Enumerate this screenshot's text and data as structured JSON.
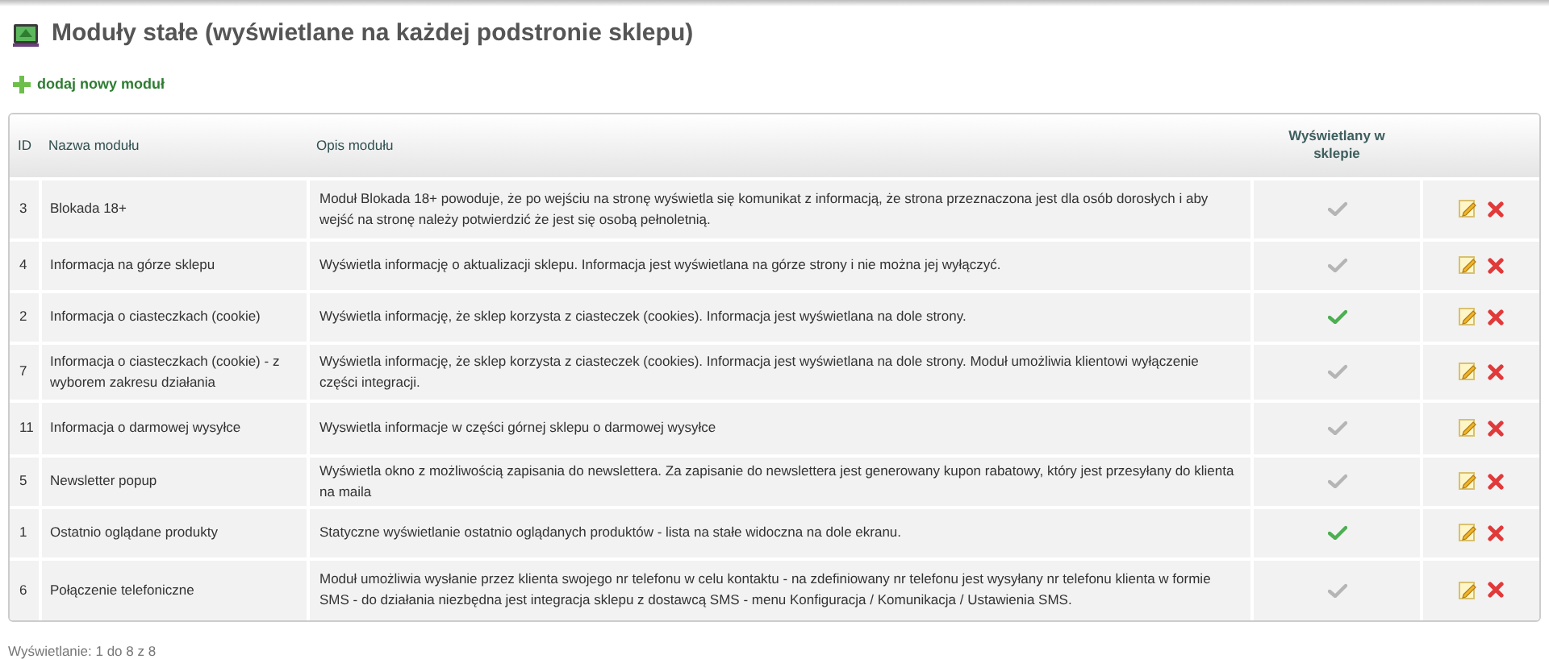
{
  "page_title": "Moduły stałe (wyświetlane na każdej podstronie sklepu)",
  "add_link": "dodaj nowy moduł",
  "table": {
    "columns": [
      "ID",
      "Nazwa modułu",
      "Opis modułu",
      "Wyświetlany w sklepie"
    ],
    "rows": [
      {
        "id": "3",
        "name": "Blokada 18+",
        "description": "Moduł Blokada 18+ powoduje, że po wejściu na stronę wyświetla się komunikat z informacją, że strona przeznaczona jest dla osób dorosłych i aby wejść na stronę należy potwierdzić że jest się osobą pełnoletnią.",
        "displayed": false
      },
      {
        "id": "4",
        "name": "Informacja na górze sklepu",
        "description": "Wyświetla informację o aktualizacji sklepu. Informacja jest wyświetlana na górze strony i nie można jej wyłączyć.",
        "displayed": false
      },
      {
        "id": "2",
        "name": "Informacja o ciasteczkach (cookie)",
        "description": "Wyświetla informację, że sklep korzysta z ciasteczek (cookies). Informacja jest wyświetlana na dole strony.",
        "displayed": true
      },
      {
        "id": "7",
        "name": "Informacja o ciasteczkach (cookie) - z wyborem zakresu działania",
        "description": "Wyświetla informację, że sklep korzysta z ciasteczek (cookies). Informacja jest wyświetlana na dole strony. Moduł umożliwia klientowi wyłączenie części integracji.",
        "displayed": false
      },
      {
        "id": "11",
        "name": "Informacja o darmowej wysyłce",
        "description": "Wyswietla informacje w części górnej sklepu o darmowej wysyłce",
        "displayed": false
      },
      {
        "id": "5",
        "name": "Newsletter popup",
        "description": "Wyświetla okno z możliwością zapisania do newslettera. Za zapisanie do newslettera jest generowany kupon rabatowy, który jest przesyłany do klienta na maila",
        "displayed": false
      },
      {
        "id": "1",
        "name": "Ostatnio oglądane produkty",
        "description": "Statyczne wyświetlanie ostatnio oglądanych produktów - lista na stałe widoczna na dole ekranu.",
        "displayed": true
      },
      {
        "id": "6",
        "name": "Połączenie telefoniczne",
        "description": "Moduł umożliwia wysłanie przez klienta swojego nr telefonu w celu kontaktu - na zdefiniowany nr telefonu jest wysyłany nr telefonu klienta w formie SMS - do działania niezbędna jest integracja sklepu z dostawcą SMS - menu Konfiguracja / Komunikacja / Ustawienia SMS.",
        "displayed": false
      }
    ]
  },
  "footer": "Wyświetlanie: 1 do 8 z 8"
}
